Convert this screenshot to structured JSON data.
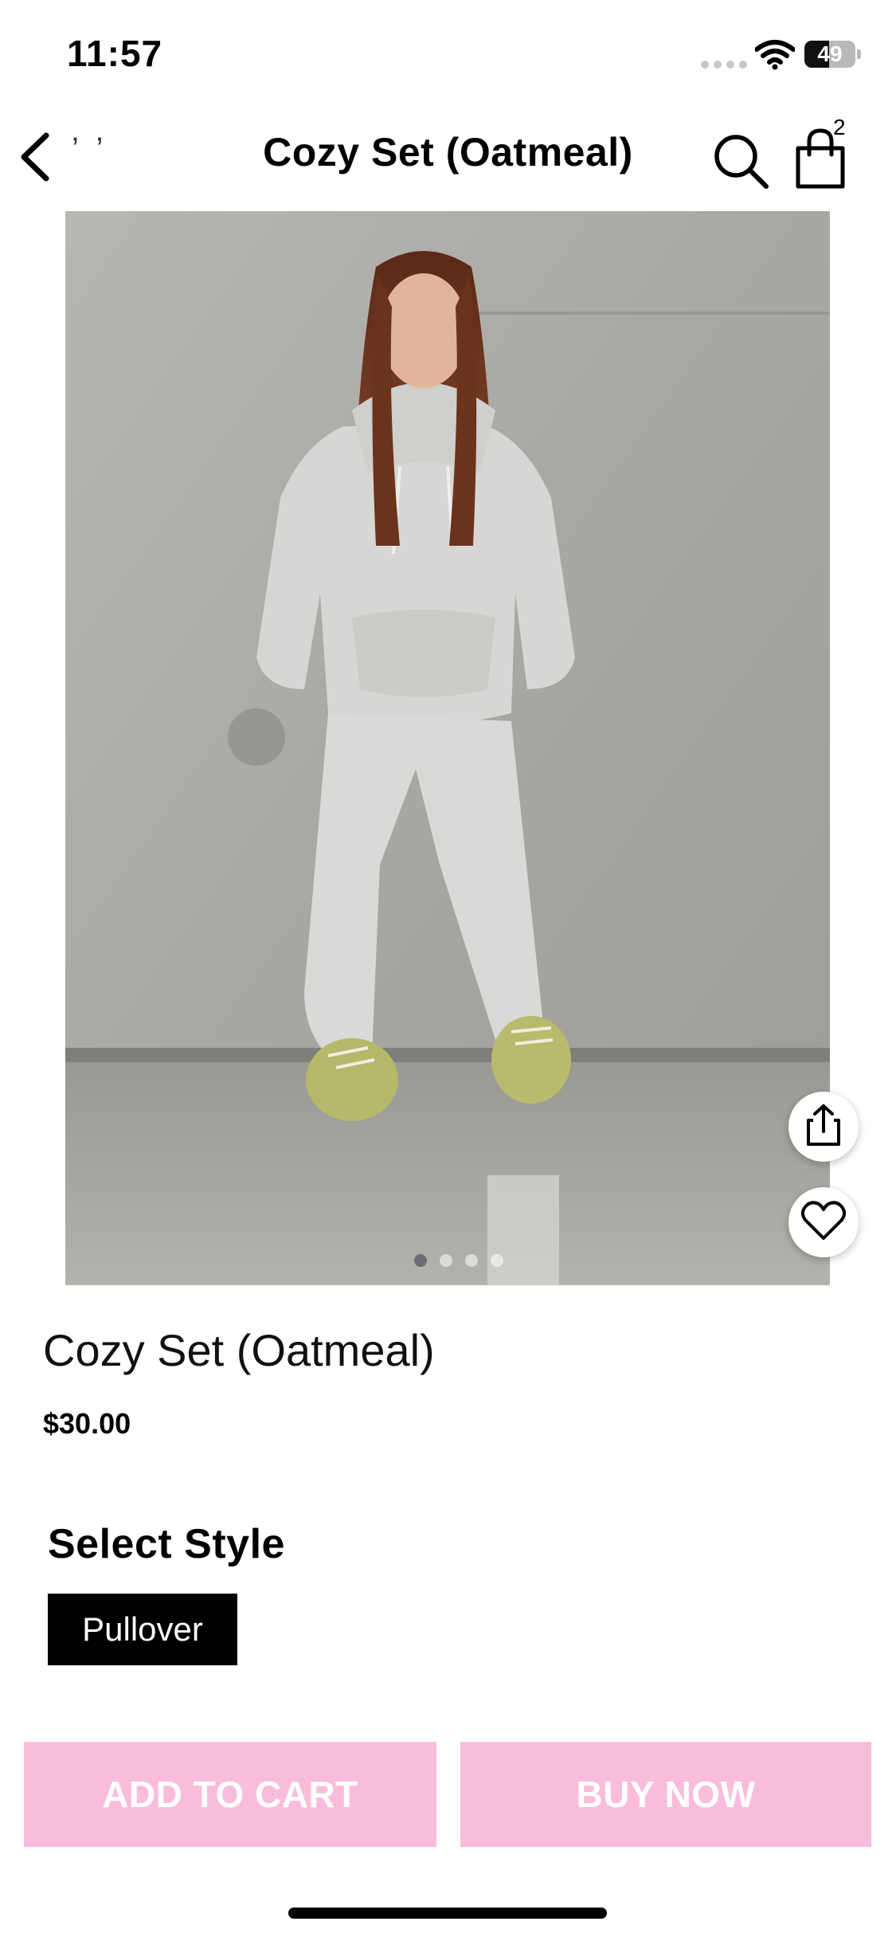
{
  "status_bar": {
    "time": "11:57",
    "battery": "49",
    "battery_level": 0.49
  },
  "header": {
    "back_text": "’ ’",
    "title": "Cozy Set (Oatmeal)",
    "cart_count": "2"
  },
  "icons": {
    "back": "chevron-left-icon",
    "search": "search-icon",
    "cart": "shopping-bag-icon",
    "share": "share-icon",
    "wishlist": "heart-icon",
    "wifi": "wifi-icon"
  },
  "gallery": {
    "image_count": 4,
    "active_index": 0
  },
  "product": {
    "name": "Cozy Set (Oatmeal)",
    "price": "$30.00",
    "style_heading": "Select Style",
    "style_options": [
      "Pullover"
    ],
    "selected_style": "Pullover"
  },
  "actions": {
    "add_to_cart": "ADD TO CART",
    "buy_now": "BUY NOW"
  },
  "colors": {
    "accent_pink": "#f9bddb",
    "selected_chip": "#000000"
  }
}
